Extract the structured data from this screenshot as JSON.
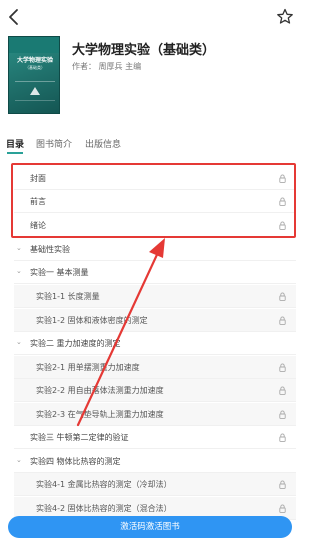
{
  "header": {
    "back_icon": "chevron-left-icon",
    "favorite_icon": "star-outline-icon"
  },
  "book": {
    "title": "大学物理实验（基础类）",
    "author": "作者：  周厚兵 主编",
    "cover_title": "大学物理实验",
    "cover_subtitle": "（基础类）"
  },
  "tabs": [
    {
      "label": "目录",
      "active": true
    },
    {
      "label": "图书简介",
      "active": false
    },
    {
      "label": "出版信息",
      "active": false
    }
  ],
  "toc": [
    {
      "label": "封面",
      "level": 0,
      "caret": "",
      "locked": true
    },
    {
      "label": "前言",
      "level": 0,
      "caret": "",
      "locked": true
    },
    {
      "label": "绪论",
      "level": 0,
      "caret": "",
      "locked": true
    },
    {
      "label": "基础性实验",
      "level": 0,
      "caret": "⌄",
      "locked": false
    },
    {
      "label": "实验一 基本测量",
      "level": 1,
      "caret": "⌄",
      "locked": false
    },
    {
      "label": "实验1-1 长度测量",
      "level": 2,
      "caret": "",
      "locked": true
    },
    {
      "label": "实验1-2 固体和液体密度的测定",
      "level": 2,
      "caret": "",
      "locked": true
    },
    {
      "label": "实验二 重力加速度的测定",
      "level": 1,
      "caret": "⌄",
      "locked": false
    },
    {
      "label": "实验2-1 用单摆测重力加速度",
      "level": 2,
      "caret": "",
      "locked": true
    },
    {
      "label": "实验2-2 用自由落体法测重力加速度",
      "level": 2,
      "caret": "",
      "locked": true
    },
    {
      "label": "实验2-3 在气垫导轨上测重力加速度",
      "level": 2,
      "caret": "",
      "locked": true
    },
    {
      "label": "实验三 牛顿第二定律的验证",
      "level": 1,
      "caret": "",
      "locked": true
    },
    {
      "label": "实验四 物体比热容的测定",
      "level": 1,
      "caret": "⌄",
      "locked": false
    },
    {
      "label": "实验4-1 金属比热容的测定（冷却法）",
      "level": 2,
      "caret": "",
      "locked": true
    },
    {
      "label": "实验4-2 固体比热容的测定（混合法）",
      "level": 2,
      "caret": "",
      "locked": true
    }
  ],
  "cta": {
    "label": "激活码激活图书"
  },
  "colors": {
    "accent": "#2aa198",
    "highlight": "#e53935",
    "cta": "#2f95f3"
  }
}
